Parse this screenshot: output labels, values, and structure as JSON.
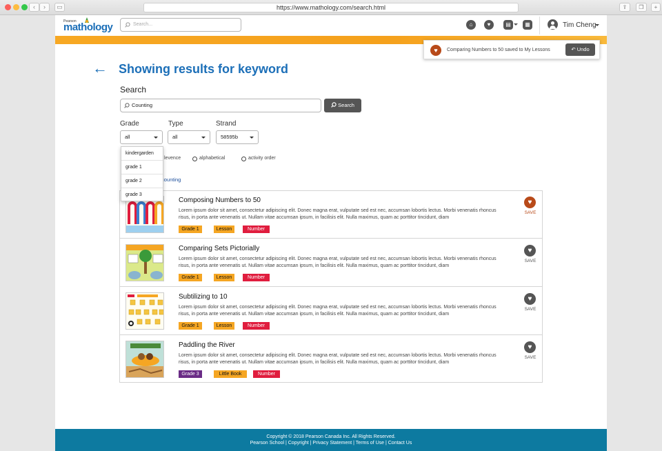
{
  "browser": {
    "url": "https://www.mathology.com/search.html"
  },
  "header": {
    "logo_small": "Pearson",
    "logo_main": "mathology",
    "search_placeholder": "Search...",
    "user_name": "Tim Cheng",
    "icons": [
      "home-icon",
      "heart-icon",
      "assignments-icon",
      "calendar-icon"
    ]
  },
  "toast": {
    "message": "Comparing Numbers to 50 saved to My Lessons",
    "undo_label": "Undo"
  },
  "main": {
    "title": "Showing results for keyword",
    "search_label": "Search",
    "search_value": "Counting",
    "search_button": "Search",
    "filters": {
      "grade_label": "Grade",
      "grade_value": "all",
      "type_label": "Type",
      "type_value": "all",
      "strand_label": "Strand",
      "strand_value": "58595b"
    },
    "grade_options": [
      "kindergarden",
      "grade 1",
      "grade 2",
      "grade 3"
    ],
    "sort_options": [
      "levence",
      "alphabetical",
      "activity order"
    ],
    "keyword_link": "counting"
  },
  "results": [
    {
      "title": "Composing Numbers to 50",
      "description": "Lorem ipsum dolor sit amet, consectetur adipiscing elit. Donec magna erat, vulputate sed est nec, accumsan lobortis lectus. Morbi venenatis rhoncus risus, in porta ante venenatis ut. Nullam vitae accumsan ipsum, in facilisis elit. Nulla maximus, quam ac porttitor tincidunt, diam",
      "grade": "Grade 1",
      "type": "Lesson",
      "strand": "Number",
      "save_label": "SAVE",
      "saved": true
    },
    {
      "title": "Comparing Sets Pictorially",
      "description": "Lorem ipsum dolor sit amet, consectetur adipiscing elit. Donec magna erat, vulputate sed est nec, accumsan lobortis lectus. Morbi venenatis rhoncus risus, in porta ante venenatis ut. Nullam vitae accumsan ipsum, in facilisis elit. Nulla maximus, quam ac porttitor tincidunt, diam",
      "grade": "Grade 1",
      "type": "Lesson",
      "strand": "Number",
      "save_label": "SAVE",
      "saved": false
    },
    {
      "title": "Subtilizing to 10",
      "description": "Lorem ipsum dolor sit amet, consectetur adipiscing elit. Donec magna erat, vulputate sed est nec, accumsan lobortis lectus. Morbi venenatis rhoncus risus, in porta ante venenatis ut. Nullam vitae accumsan ipsum, in facilisis elit. Nulla maximus, quam ac porttitor tincidunt, diam",
      "grade": "Grade 1",
      "type": "Lesson",
      "strand": "Number",
      "save_label": "SAVE",
      "saved": false
    },
    {
      "title": "Paddling the River",
      "description": "Lorem ipsum dolor sit amet, consectetur adipiscing elit. Donec magna erat, vulputate sed est nec, accumsan lobortis lectus. Morbi venenatis rhoncus risus, in porta ante venenatis ut. Nullam vitae accumsan ipsum, in facilisis elit. Nulla maximus, quam ac porttitor tincidunt, diam",
      "grade": "Grade 3",
      "type": "Little Book",
      "strand": "Number",
      "save_label": "SAVE",
      "saved": false
    }
  ],
  "footer": {
    "copyright": "Copyright © 2018 Pearson Canada Inc. All Rights Reserved.",
    "links": "Pearson School | Copyright | Privacy Statement | Terms of Use | Contact Us"
  },
  "colors": {
    "brand_blue": "#1c6fb8",
    "orange_bar": "#f5a11c",
    "saved_heart": "#b84a19",
    "tag_orange": "#f5a623",
    "tag_red": "#e01d3e",
    "tag_purple": "#6a2c86",
    "footer": "#0d7aa0"
  }
}
